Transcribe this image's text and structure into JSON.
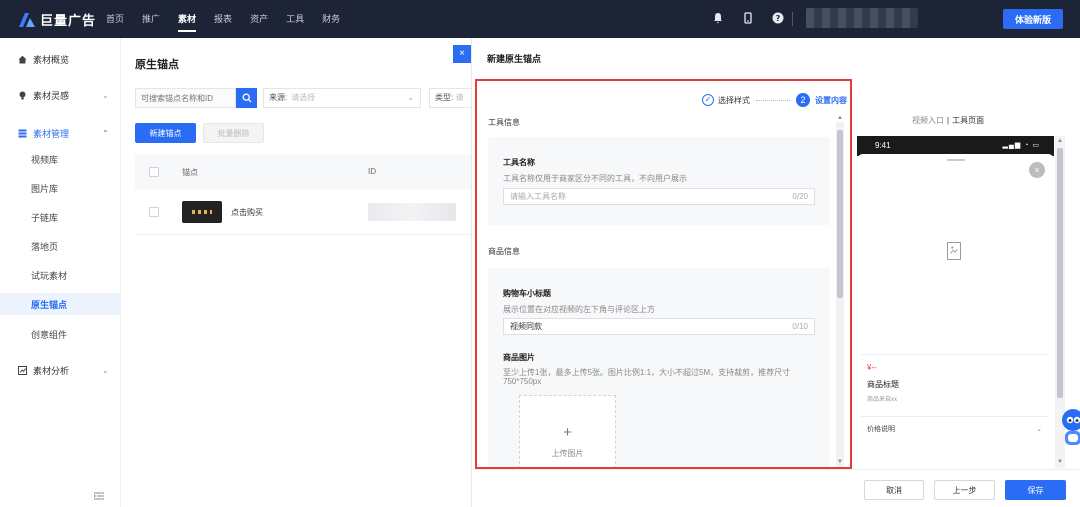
{
  "topbar": {
    "logo_text": "巨量广告",
    "nav": [
      "首页",
      "推广",
      "素材",
      "报表",
      "资产",
      "工具",
      "财务"
    ],
    "active_nav": "素材",
    "try_button": "体验新版"
  },
  "sidebar": {
    "groups": [
      {
        "label": "素材概览",
        "icon": "home-icon"
      },
      {
        "label": "素材灵感",
        "icon": "bulb-icon"
      },
      {
        "label": "素材管理",
        "icon": "stack-icon"
      },
      {
        "label": "素材分析",
        "icon": "analysis-icon"
      }
    ],
    "items": [
      "视频库",
      "图片库",
      "子链库",
      "落地页",
      "试玩素材",
      "原生锚点",
      "创意组件"
    ],
    "active_item": "原生锚点"
  },
  "list": {
    "title": "原生锚点",
    "search_placeholder": "可搜索锚点名称和ID",
    "source_label": "来源:",
    "source_placeholder": "请选择",
    "type_label": "类型:",
    "type_placeholder": "请",
    "new_button": "新建锚点",
    "batch_delete_button": "批量删除",
    "columns": [
      "锚点",
      "ID"
    ],
    "rows": [
      {
        "name": "点击购买"
      }
    ]
  },
  "drawer": {
    "title": "新建原生锚点",
    "steps": [
      {
        "label": "选择样式",
        "state": "done"
      },
      {
        "label": "设置内容",
        "number": "2",
        "state": "active"
      }
    ],
    "tool_section": "工具信息",
    "tool_name": {
      "title": "工具名称",
      "help": "工具名称仅用于商家区分不同的工具，不向用户展示",
      "placeholder": "请输入工具名称",
      "count": "0/20"
    },
    "product_section": "商品信息",
    "cart_title": {
      "title": "购物车小标题",
      "help": "展示位置在对应视频的左下角与评论区上方",
      "value": "视频同款",
      "count": "0/10"
    },
    "product_image": {
      "title": "商品图片",
      "help": "至少上传1张，最多上传5张。图片比例1:1，大小不超过5M，支持裁剪，推荐尺寸750*750px",
      "upload_label": "上传图片"
    },
    "preview": {
      "tab_entry": "视频入口",
      "tab_page": "工具页面",
      "time": "9:41",
      "price": "¥--",
      "product_title": "商品标题",
      "product_from": "商品来自xx",
      "price_note": "价格说明"
    },
    "footer": {
      "cancel": "取消",
      "prev": "上一步",
      "save": "保存"
    }
  },
  "colors": {
    "primary": "#2a6df4",
    "topbar": "#1c2436",
    "highlight_frame": "#e53b3b"
  }
}
